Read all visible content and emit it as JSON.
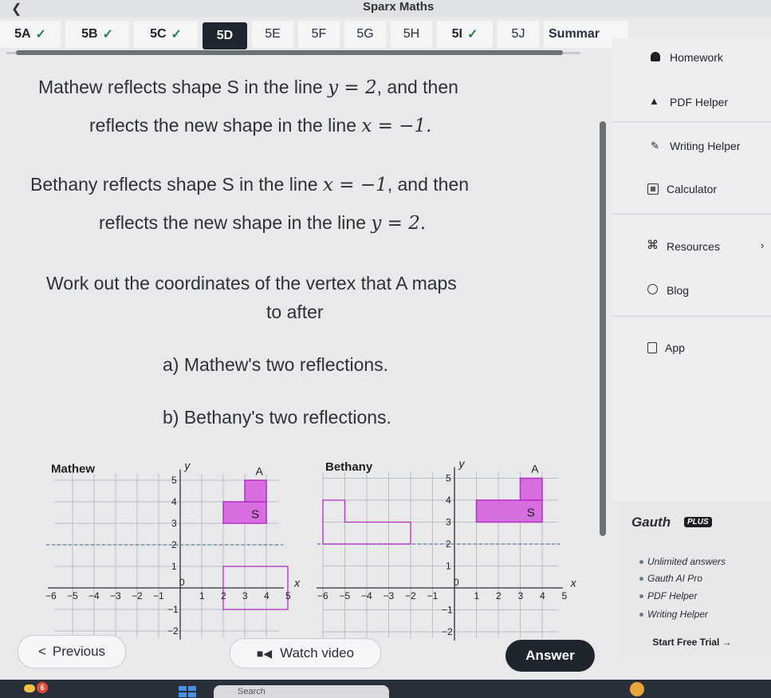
{
  "window": {
    "title": "Sparx Maths",
    "back_icon": "chevron-left-icon"
  },
  "tabs": [
    {
      "label": "5A",
      "done": true
    },
    {
      "label": "5B",
      "done": true
    },
    {
      "label": "5C",
      "done": true
    },
    {
      "label": "5D",
      "current": true
    },
    {
      "label": "5E"
    },
    {
      "label": "5F"
    },
    {
      "label": "5G"
    },
    {
      "label": "5H"
    },
    {
      "label": "5I",
      "done": true
    },
    {
      "label": "5J"
    },
    {
      "label": "Summar"
    }
  ],
  "question": {
    "p1a": "Mathew reflects shape S in the line ",
    "p1a_eq": "y = 2",
    "p1a_tail": ", and then",
    "p1b": "reflects the new shape in the line ",
    "p1b_eq": "x = −1.",
    "p2a": "Bethany reflects shape S in the line ",
    "p2a_eq": "x = −1",
    "p2a_tail": ", and then",
    "p2b": "reflects the new shape in the line ",
    "p2b_eq": "y = 2.",
    "p3a": "Work out the coordinates of the vertex that A maps",
    "p3b": "to after",
    "part_a": "a) Mathew's two reflections.",
    "part_b": "b) Bethany's two reflections."
  },
  "graphs": {
    "left": {
      "name": "Mathew",
      "shape_label": "S",
      "vertex_label": "A",
      "y_axis": "y",
      "x_axis": "x",
      "x_ticks": [
        "−6",
        "−5",
        "−4",
        "−3",
        "−2",
        "−1",
        "0",
        "1",
        "2",
        "3",
        "4",
        "5"
      ],
      "y_ticks": [
        "5",
        "4",
        "3",
        "2",
        "1",
        "−1",
        "−2"
      ]
    },
    "right": {
      "name": "Bethany",
      "shape_label": "S",
      "vertex_label": "A",
      "y_axis": "y",
      "x_axis": "x",
      "x_ticks": [
        "−6",
        "−5",
        "−4",
        "−3",
        "−2",
        "−1",
        "0",
        "1",
        "2",
        "3",
        "4",
        "5"
      ],
      "y_ticks": [
        "5",
        "4",
        "3",
        "2",
        "1",
        "−1",
        "−2"
      ]
    },
    "colors": {
      "shape_fill": "#d66ee0",
      "shape_stroke": "#b32fc2",
      "dashed_line": "#6f8fa8",
      "grid": "#b8bfc5"
    }
  },
  "sidebar": {
    "items": [
      {
        "label": "Homework",
        "icon": "homework-icon"
      },
      {
        "label": "PDF Helper",
        "icon": "pdf-icon"
      },
      {
        "label": "Writing Helper",
        "icon": "pencil-icon"
      },
      {
        "label": "Calculator",
        "icon": "calculator-icon"
      },
      {
        "label": "Resources",
        "icon": "resources-icon"
      },
      {
        "label": "Blog",
        "icon": "blog-icon"
      },
      {
        "label": "App",
        "icon": "app-icon"
      }
    ]
  },
  "gauth": {
    "brand": "Gauth",
    "badge": "PLUS",
    "features": [
      "Unlimited answers",
      "Gauth AI Pro",
      "PDF Helper",
      "Writing Helper"
    ],
    "cta": "Start Free Trial →"
  },
  "nav": {
    "previous": "Previous",
    "watch_video": "Watch video",
    "answer": "Answer"
  },
  "taskbar": {
    "search_placeholder": "Search",
    "notification_count": "6"
  }
}
